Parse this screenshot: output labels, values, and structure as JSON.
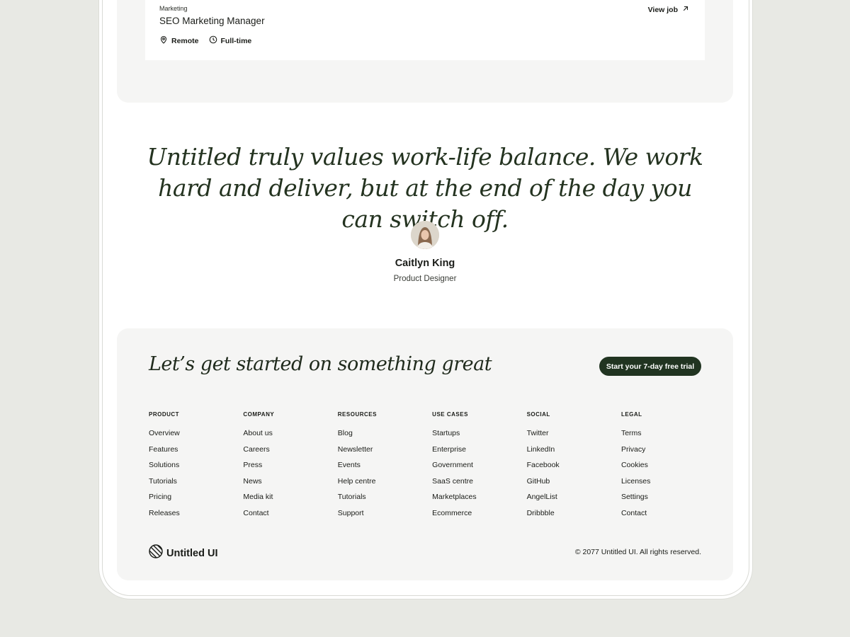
{
  "job": {
    "department": "Marketing",
    "title": "SEO Marketing Manager",
    "location": "Remote",
    "type": "Full-time",
    "view_label": "View job"
  },
  "testimonial": {
    "quote": "Untitled truly values work-life balance. We work hard and deliver, but at the end of the day you can switch off.",
    "author_name": "Caitlyn King",
    "author_role": "Product Designer"
  },
  "cta": {
    "heading": "Let’s get started on something great",
    "button_label": "Start your 7-day free trial"
  },
  "footer": {
    "columns": [
      {
        "heading": "PRODUCT",
        "links": [
          "Overview",
          "Features",
          "Solutions",
          "Tutorials",
          "Pricing",
          "Releases"
        ]
      },
      {
        "heading": "COMPANY",
        "links": [
          "About us",
          "Careers",
          "Press",
          "News",
          "Media kit",
          "Contact"
        ]
      },
      {
        "heading": "RESOURCES",
        "links": [
          "Blog",
          "Newsletter",
          "Events",
          "Help centre",
          "Tutorials",
          "Support"
        ]
      },
      {
        "heading": "USE CASES",
        "links": [
          "Startups",
          "Enterprise",
          "Government",
          "SaaS centre",
          "Marketplaces",
          "Ecommerce"
        ]
      },
      {
        "heading": "SOCIAL",
        "links": [
          "Twitter",
          "LinkedIn",
          "Facebook",
          "GitHub",
          "AngelList",
          "Dribbble"
        ]
      },
      {
        "heading": "LEGAL",
        "links": [
          "Terms",
          "Privacy",
          "Cookies",
          "Licenses",
          "Settings",
          "Contact"
        ]
      }
    ],
    "brand_name": "Untitled UI",
    "copyright": "© 2077 Untitled UI. All rights reserved."
  },
  "colors": {
    "page_background": "#e8e9e4",
    "panel_background": "#f5f5f4",
    "accent_dark_green": "#213421",
    "quote_text": "#243320"
  },
  "icons": {
    "location": "map-pin-icon",
    "clock": "clock-icon",
    "external": "arrow-up-right-icon",
    "logo": "striped-circle-logo-icon"
  }
}
